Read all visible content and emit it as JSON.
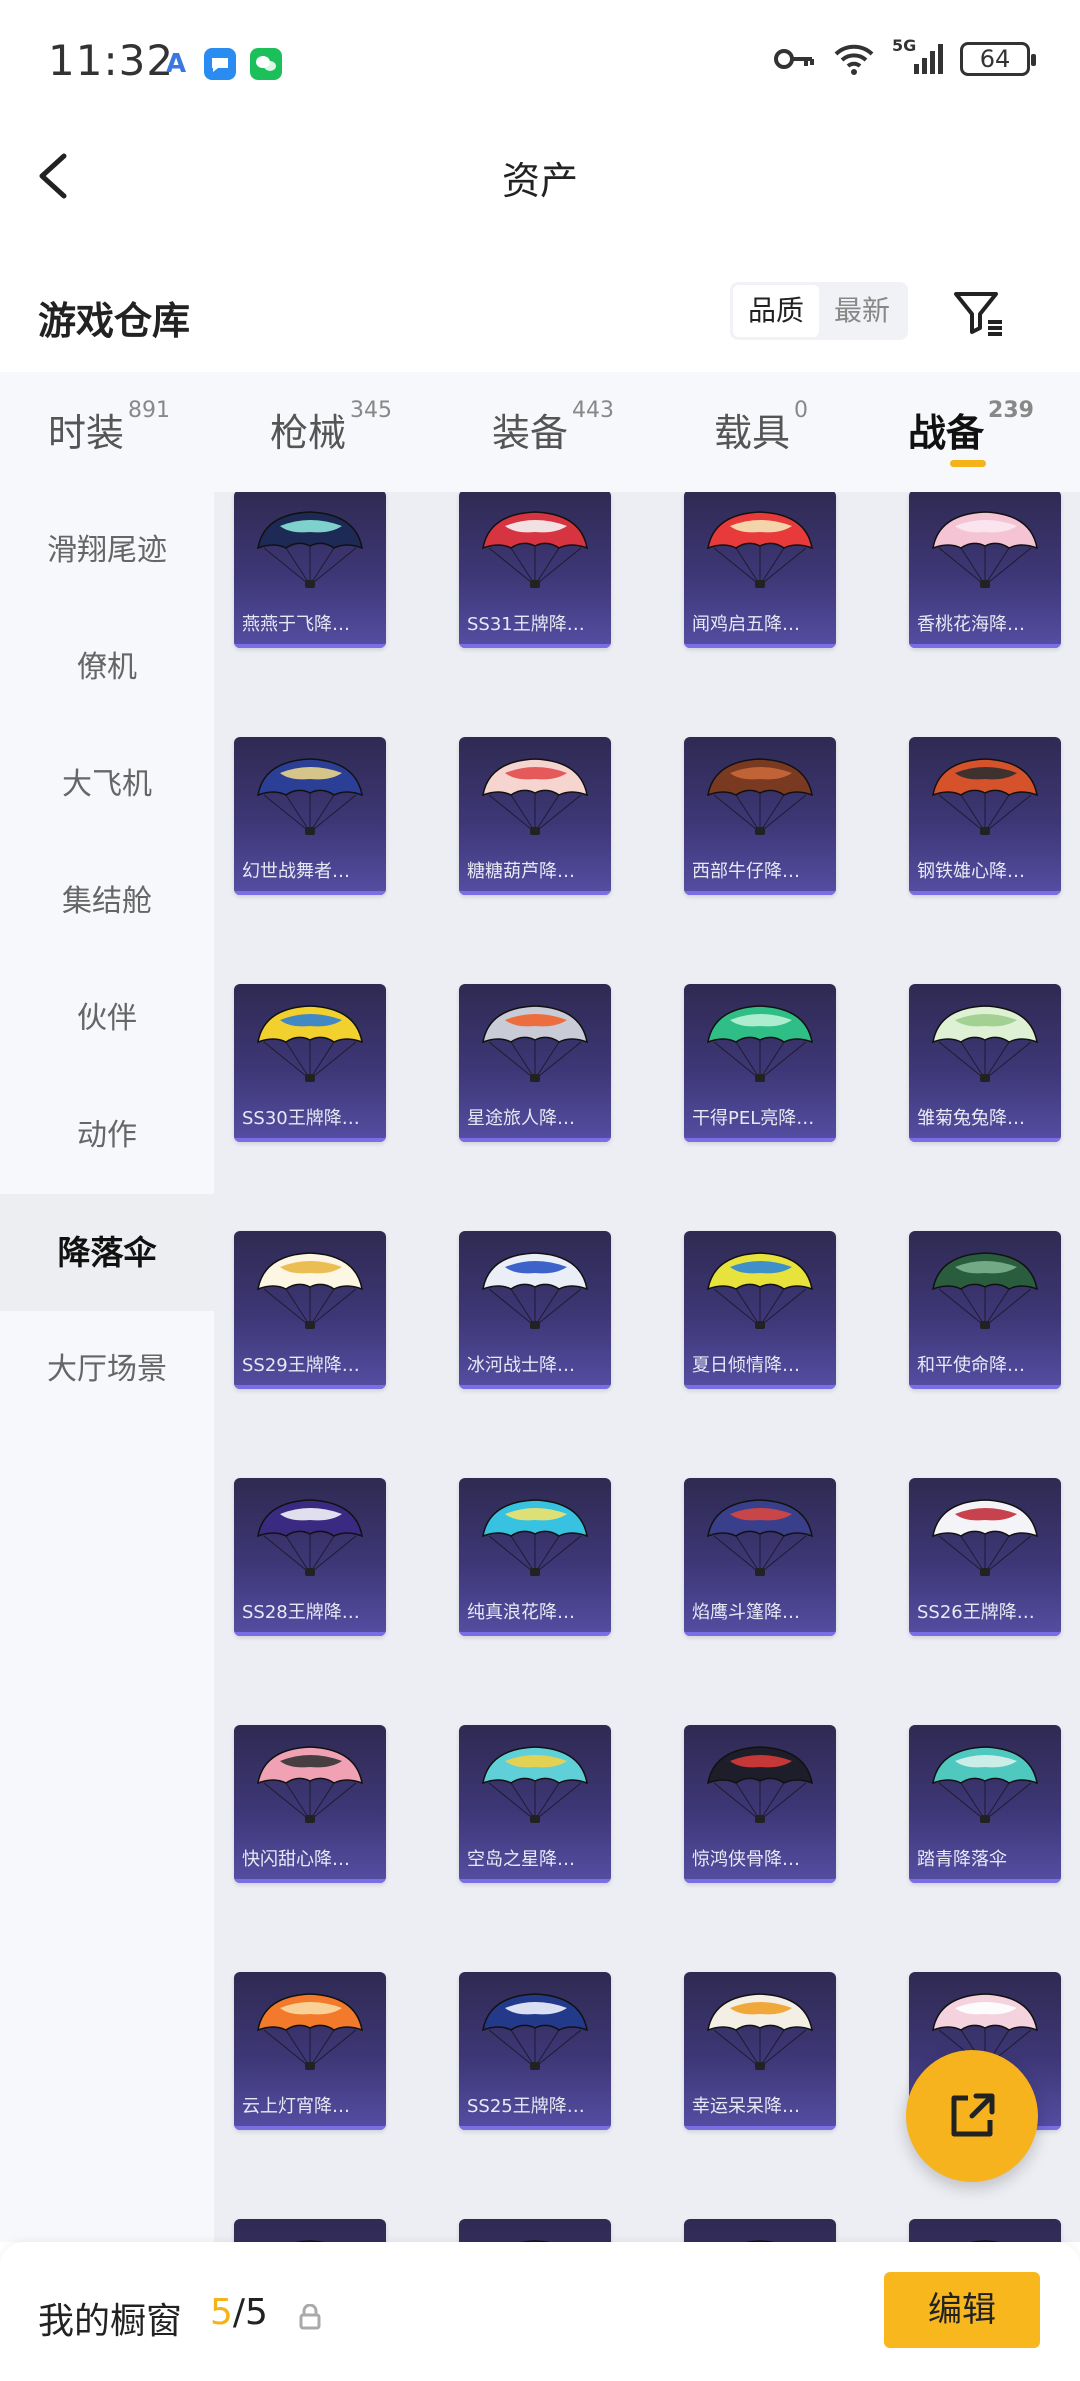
{
  "status_bar": {
    "time": "11:32",
    "network": "5G",
    "battery": "64",
    "apps": [
      "a-app-icon",
      "message-app-icon",
      "wechat-app-icon"
    ]
  },
  "nav": {
    "title": "资产"
  },
  "header": {
    "title": "游戏仓库",
    "sort_options": [
      "品质",
      "最新"
    ],
    "active_sort": "品质"
  },
  "tabs": [
    {
      "label": "时装",
      "count": "891"
    },
    {
      "label": "枪械",
      "count": "345"
    },
    {
      "label": "装备",
      "count": "443"
    },
    {
      "label": "载具",
      "count": "0"
    },
    {
      "label": "战备",
      "count": "239"
    }
  ],
  "active_tab": "战备",
  "sidebar": {
    "items": [
      "滑翔尾迹",
      "僚机",
      "大飞机",
      "集结舱",
      "伙伴",
      "动作",
      "降落伞",
      "大厅场景"
    ],
    "active": "降落伞"
  },
  "items": [
    {
      "name": "燕燕于飞降…",
      "colors": [
        "#1d2a55",
        "#8be3d8"
      ]
    },
    {
      "name": "SS31王牌降…",
      "colors": [
        "#d73442",
        "#f4f4f4"
      ]
    },
    {
      "name": "闻鸡启五降…",
      "colors": [
        "#e83a3a",
        "#f5e7b8"
      ]
    },
    {
      "name": "香桃花海降…",
      "colors": [
        "#f5c4d4",
        "#fbe8ef"
      ]
    },
    {
      "name": "幻世战舞者…",
      "colors": [
        "#2c3f96",
        "#e9d489"
      ]
    },
    {
      "name": "糖糖葫芦降…",
      "colors": [
        "#f6d4cf",
        "#e24d4d"
      ]
    },
    {
      "name": "西部牛仔降…",
      "colors": [
        "#7a3a22",
        "#c8683a"
      ]
    },
    {
      "name": "钢铁雄心降…",
      "colors": [
        "#d6522a",
        "#2f2f2f"
      ]
    },
    {
      "name": "SS30王牌降…",
      "colors": [
        "#f2d12e",
        "#2d7fd6"
      ]
    },
    {
      "name": "星途旅人降…",
      "colors": [
        "#c9ccd6",
        "#f0642d"
      ]
    },
    {
      "name": "干得PEL亮降…",
      "colors": [
        "#2fbf86",
        "#b9f2d6"
      ]
    },
    {
      "name": "雏菊兔兔降…",
      "colors": [
        "#dff1d4",
        "#9ccc8c"
      ]
    },
    {
      "name": "SS29王牌降…",
      "colors": [
        "#fdf6e2",
        "#e9b844"
      ]
    },
    {
      "name": "冰河战士降…",
      "colors": [
        "#e9eef7",
        "#2a52c4"
      ]
    },
    {
      "name": "夏日倾情降…",
      "colors": [
        "#e7e33c",
        "#2c86d8"
      ]
    },
    {
      "name": "和平使命降…",
      "colors": [
        "#2a5d3e",
        "#7bb38d"
      ]
    },
    {
      "name": "SS28王牌降…",
      "colors": [
        "#3a2a82",
        "#f3f3f8"
      ]
    },
    {
      "name": "纯真浪花降…",
      "colors": [
        "#36c2e0",
        "#f0e36a"
      ]
    },
    {
      "name": "焰鹰斗篷降…",
      "colors": [
        "#3a3f8c",
        "#d8473f"
      ]
    },
    {
      "name": "SS26王牌降…",
      "colors": [
        "#f4f4f8",
        "#c32f3a"
      ]
    },
    {
      "name": "快闪甜心降…",
      "colors": [
        "#f0a2b4",
        "#333333"
      ]
    },
    {
      "name": "空岛之星降…",
      "colors": [
        "#5fd0d8",
        "#f2d046"
      ]
    },
    {
      "name": "惊鸿侠骨降…",
      "colors": [
        "#1e1e2a",
        "#d83a3a"
      ]
    },
    {
      "name": "踏青降落伞",
      "colors": [
        "#4fc8c0",
        "#d8f1ec"
      ]
    },
    {
      "name": "云上灯宵降…",
      "colors": [
        "#f27a2a",
        "#f9d9a2"
      ]
    },
    {
      "name": "SS25王牌降…",
      "colors": [
        "#233a8a",
        "#eef2ff"
      ]
    },
    {
      "name": "幸运呆呆降…",
      "colors": [
        "#f3efe4",
        "#f0a028"
      ]
    },
    {
      "name": "",
      "colors": [
        "#f4d2de",
        "#ffffff"
      ]
    },
    {
      "name": "",
      "colors": [
        "#3a3470",
        "#e6e6ee"
      ]
    },
    {
      "name": "",
      "colors": [
        "#3a3470",
        "#f0b2c6"
      ]
    },
    {
      "name": "",
      "colors": [
        "#3a3470",
        "#7b6fd8"
      ]
    },
    {
      "name": "",
      "colors": [
        "#3a3470",
        "#5f5ab8"
      ]
    }
  ],
  "bottom": {
    "label": "我的橱窗",
    "current": "5",
    "total": "5",
    "edit_label": "编辑"
  },
  "accent_color": "#f5b31a"
}
